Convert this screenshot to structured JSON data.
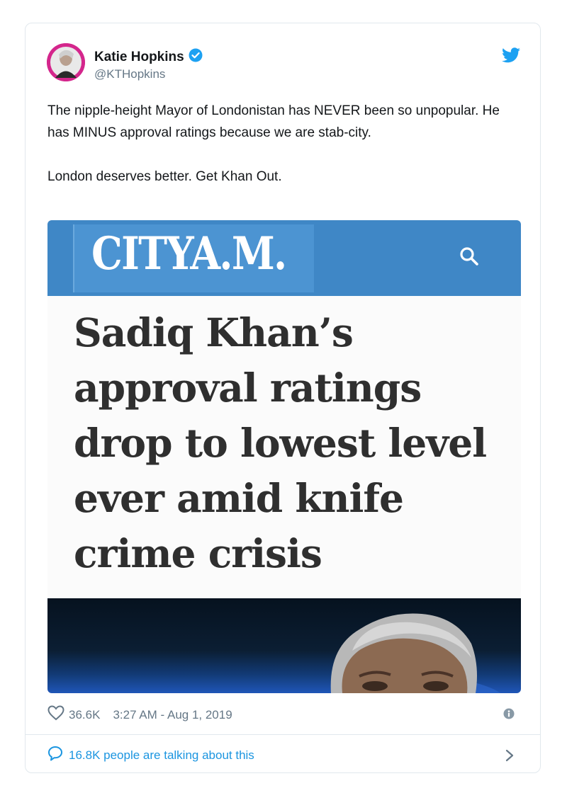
{
  "user": {
    "name": "Katie Hopkins",
    "handle": "@KTHopkins",
    "verified": true
  },
  "tweet": {
    "text": "The nipple-height Mayor of Londonistan has NEVER been so unpopular. He has MINUS approval ratings because we are stab-city.\n\nLondon deserves better. Get Khan Out."
  },
  "media": {
    "logo": "CITYA.M.",
    "headline": "Sadiq Khan’s approval ratings drop to lowest level ever amid knife crime crisis"
  },
  "stats": {
    "likes": "36.6K",
    "time": "3:27 AM - Aug 1, 2019",
    "talking": "16.8K people are talking about this"
  },
  "icons": {
    "twitter": "twitter-bird-icon",
    "verified": "verified-badge-icon",
    "like": "heart-icon",
    "info": "info-icon",
    "reply": "speech-bubble-icon",
    "chevron": "chevron-right-icon",
    "search": "search-icon"
  },
  "colors": {
    "accent": "#1da1f2",
    "link": "#1b95e0",
    "masthead": "#3f87c6",
    "text": "#14171a",
    "muted": "#657786"
  }
}
